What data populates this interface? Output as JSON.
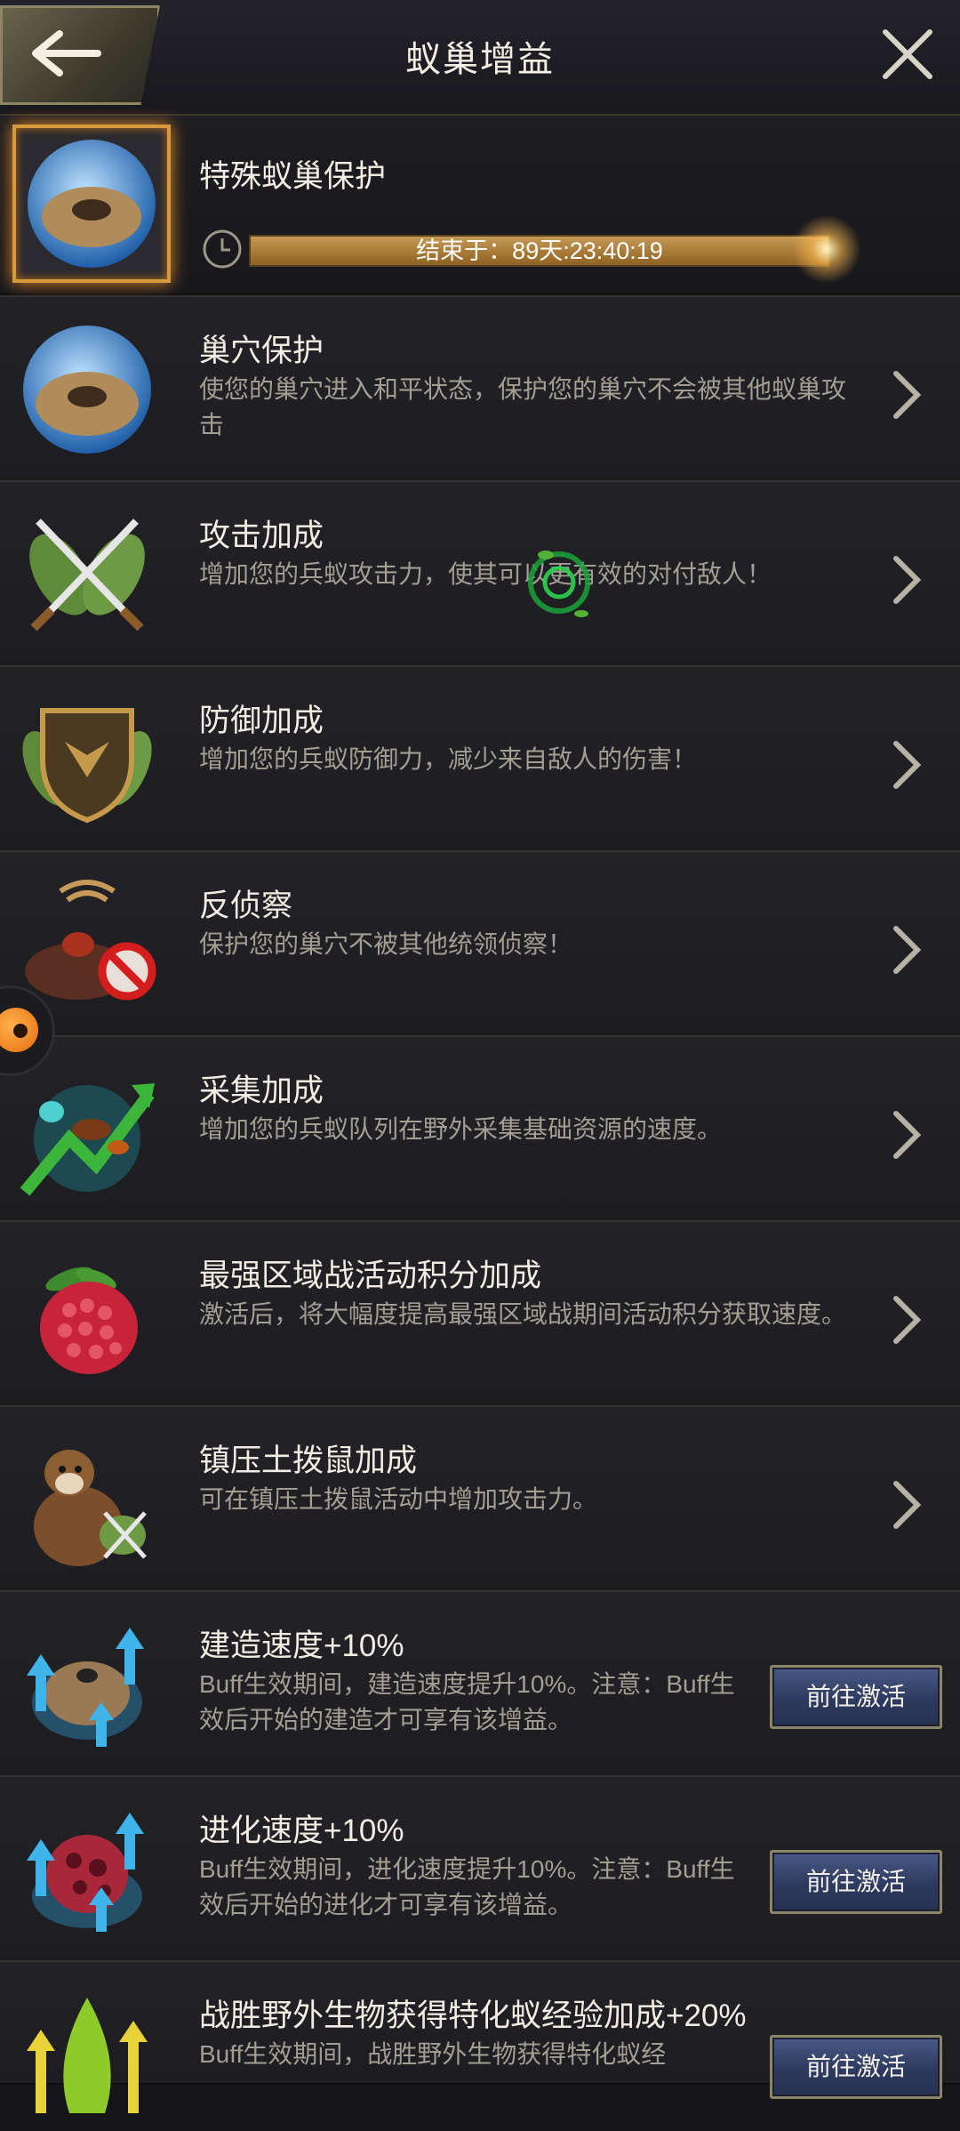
{
  "header": {
    "title": "蚁巢增益",
    "back_icon": "back-arrow-icon",
    "close_icon": "close-icon"
  },
  "special": {
    "name": "特殊蚁巢保护",
    "timer_prefix": "结束于：",
    "timer_value": "89天:23:40:19"
  },
  "items": [
    {
      "name": "巢穴保护",
      "desc": "使您的巢穴进入和平状态，保护您的巢穴不会被其他蚁巢攻击",
      "icon": "nest-shield-icon"
    },
    {
      "name": "攻击加成",
      "desc": "增加您的兵蚁攻击力，使其可以更有效的对付敌人！",
      "icon": "crossed-swords-icon"
    },
    {
      "name": "防御加成",
      "desc": "增加您的兵蚁防御力，减少来自敌人的伤害！",
      "icon": "shield-emblem-icon"
    },
    {
      "name": "反侦察",
      "desc": "保护您的巢穴不被其他统领侦察！",
      "icon": "anti-scout-icon"
    },
    {
      "name": "采集加成",
      "desc": "增加您的兵蚁队列在野外采集基础资源的速度。",
      "icon": "gather-ant-icon"
    },
    {
      "name": "最强区域战活动积分加成",
      "desc": "激活后，将大幅度提高最强区域战期间活动积分获取速度。",
      "icon": "raspberry-icon"
    },
    {
      "name": "镇压土拨鼠加成",
      "desc": "可在镇压土拨鼠活动中增加攻击力。",
      "icon": "groundhog-icon"
    },
    {
      "name": "建造速度+10%",
      "desc": "Buff生效期间，建造速度提升10%。注意：Buff生效后开始的建造才可享有该增益。",
      "icon": "build-speed-icon",
      "button": "前往激活"
    },
    {
      "name": "进化速度+10%",
      "desc": "Buff生效期间，进化速度提升10%。注意：Buff生效后开始的进化才可享有该增益。",
      "icon": "evolution-speed-icon",
      "button": "前往激活"
    },
    {
      "name": "战胜野外生物获得特化蚁经验加成+20%",
      "desc": "Buff生效期间，战胜野外生物获得特化蚁经",
      "icon": "exp-boost-icon",
      "button": "前往激活"
    }
  ]
}
